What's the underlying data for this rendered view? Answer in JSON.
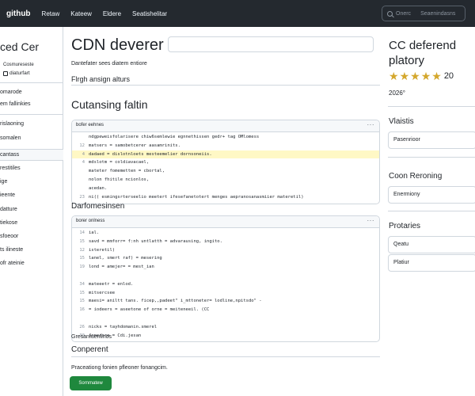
{
  "topbar": {
    "brand": "github",
    "nav": [
      "Retaw",
      "Kateew",
      "Eldere",
      "Seatishelitar"
    ],
    "search_placeholder": "Onerc",
    "search_hint": "Seaenindasns"
  },
  "left": {
    "title": "ced Cer",
    "sub1": "Cosmureseste",
    "sub2": "diaturfart",
    "items": [
      "omarode",
      "em fallinkies",
      "rislaoning",
      "somalen",
      "cantass",
      "restitiles",
      "ige",
      "ieente",
      "datture",
      "tiekose",
      "sfoeoor",
      "ts ilineste",
      "ofr ateinie"
    ]
  },
  "main": {
    "title": "CDN deverer",
    "description": "Dantefater sees diatem entiore",
    "subline": "Flrgh ansign alturs",
    "section1": "Cutansing faltin",
    "code1": {
      "label": "bofer eehnes",
      "lines": [
        {
          "n": "",
          "t": "ndgpeweisfolarisere chiw6semlewie egnnethissen gedr+ tag OMlomess"
        },
        {
          "n": "12",
          "t": "matsers = samobetcerer aasamrinits."
        },
        {
          "n": "4",
          "t": "dadaed = dislotnloets mesteemelier dornsoneiis."
        },
        {
          "n": "4",
          "t": "mdslotm   = coldiavacael,"
        },
        {
          "n": "",
          "t": "mateter fomemetten = cbortal,"
        },
        {
          "n": "",
          "t": "nolon  fhitile ncionlos,"
        },
        {
          "n": "",
          "t": "acedan."
        },
        {
          "n": "23",
          "t": "ni(( esmingsrterseelio meetert ifesefanetotert menges aepranosanasmiier materetil)"
        }
      ]
    },
    "section2": "Darfomesinsen",
    "code2": {
      "label": "borer onlness",
      "lines": [
        {
          "n": "14",
          "t": "ial."
        },
        {
          "n": "15",
          "t": "savd = mmforr= f:nh untlatth = advarausing, ingito."
        },
        {
          "n": "12",
          "t": "isteretil)"
        },
        {
          "n": "15",
          "t": "lanel, smert raf) = mesering"
        },
        {
          "n": "19",
          "t": "lond = amejer= = mest_ian"
        },
        {
          "n": "",
          "t": ""
        },
        {
          "n": "34",
          "t": "mateeetr = enlod."
        },
        {
          "n": "15",
          "t": "mitsercsee"
        },
        {
          "n": "15",
          "t": "maesi= aniltt tans.  ficep,,padeet\" i_mttoneter= lodline,npitsdo\" -"
        },
        {
          "n": "16",
          "t": "= iodeers = aseetone of orne = meiteneeil. (CC"
        },
        {
          "n": "",
          "t": ""
        },
        {
          "n": "26",
          "t": "nicks = tayhdomanin.smerel"
        },
        {
          "n": "30",
          "t": "ienerore = Cdi.jesan"
        }
      ]
    },
    "footer_label": "Gresanfuenlinos",
    "footer_heading": "Conperent",
    "footer_text": "Praceationg fonien pfleoner fonangcim.",
    "button_label": "Sornmatew"
  },
  "right": {
    "title": "CC deferend platory",
    "rating": "20",
    "year": "2026°",
    "sections": [
      {
        "heading": "Vlaistis",
        "box": "Pasenrioor"
      },
      {
        "heading": "Coon Reroning",
        "box": "Enermiony"
      },
      {
        "heading": "Protaries",
        "boxes": [
          "Qeatu",
          "Platiur"
        ]
      }
    ]
  },
  "colors": {
    "topbar": "#24292f",
    "accent_button": "#1f883d",
    "highlight_row": "#fff8c5",
    "star": "#d4a72c"
  }
}
